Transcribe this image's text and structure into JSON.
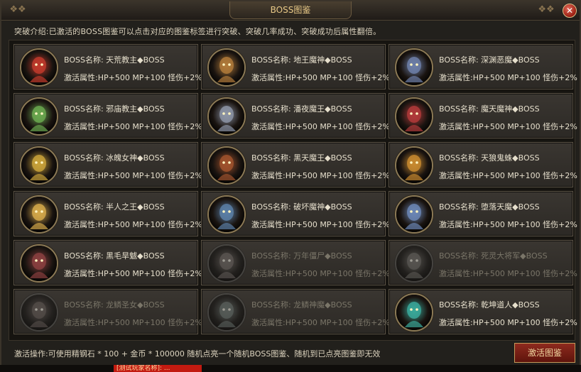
{
  "window": {
    "title": "BOSS图鉴",
    "close_symbol": "✕"
  },
  "intro_text": "突破介绍:已激活的BOSS图鉴可以点击对应的图鉴标签进行突破、突破几率成功、突破成功后属性翻倍。",
  "bosses": [
    {
      "name": "BOSS名称: 天荒教主◆BOSS",
      "attr": "激活属性:HP+500 MP+100 怪伤+2%",
      "locked": false,
      "color": "#c0392b"
    },
    {
      "name": "BOSS名称: 地王魔神◆BOSS",
      "attr": "激活属性:HP+500 MP+100 怪伤+2%",
      "locked": false,
      "color": "#b07a3a"
    },
    {
      "name": "BOSS名称: 深渊恶魔◆BOSS",
      "attr": "激活属性:HP+500 MP+100 怪伤+2%",
      "locked": false,
      "color": "#6d7fa8"
    },
    {
      "name": "BOSS名称: 邪庙教主◆BOSS",
      "attr": "激活属性:HP+500 MP+100 怪伤+2%",
      "locked": false,
      "color": "#6aa84f"
    },
    {
      "name": "BOSS名称: 潘夜魔王◆BOSS",
      "attr": "激活属性:HP+500 MP+100 怪伤+2%",
      "locked": false,
      "color": "#8c94a6"
    },
    {
      "name": "BOSS名称: 魔天魔神◆BOSS",
      "attr": "激活属性:HP+500 MP+100 怪伤+2%",
      "locked": false,
      "color": "#b03a3a"
    },
    {
      "name": "BOSS名称: 冰魄女神◆BOSS",
      "attr": "激活属性:HP+500 MP+100 怪伤+2%",
      "locked": false,
      "color": "#c9a23a"
    },
    {
      "name": "BOSS名称: 黑天魔王◆BOSS",
      "attr": "激活属性:HP+500 MP+100 怪伤+2%",
      "locked": false,
      "color": "#a0522d"
    },
    {
      "name": "BOSS名称: 天狼鬼蛛◆BOSS",
      "attr": "激活属性:HP+500 MP+100 怪伤+2%",
      "locked": false,
      "color": "#c8892f"
    },
    {
      "name": "BOSS名称: 半人之王◆BOSS",
      "attr": "激活属性:HP+500 MP+100 怪伤+2%",
      "locked": false,
      "color": "#d4a84a"
    },
    {
      "name": "BOSS名称: 破坏魔神◆BOSS",
      "attr": "激活属性:HP+500 MP+100 怪伤+2%",
      "locked": false,
      "color": "#5b7fa6"
    },
    {
      "name": "BOSS名称: 堕落天魔◆BOSS",
      "attr": "激活属性:HP+500 MP+100 怪伤+2%",
      "locked": false,
      "color": "#6b86b5"
    },
    {
      "name": "BOSS名称: 黑毛旱魃◆BOSS",
      "attr": "激活属性:HP+500 MP+100 怪伤+2%",
      "locked": false,
      "color": "#8a3f3f"
    },
    {
      "name": "BOSS名称: 万年僵尸◆BOSS",
      "attr": "激活属性:HP+500 MP+100 怪伤+2%",
      "locked": true,
      "color": "#8a6b5a"
    },
    {
      "name": "BOSS名称: 死灵大将军◆BOSS",
      "attr": "激活属性:HP+500 MP+100 怪伤+2%",
      "locked": true,
      "color": "#7a7060"
    },
    {
      "name": "BOSS名称: 龙鳞圣女◆BOSS",
      "attr": "激活属性:HP+500 MP+100 怪伤+2%",
      "locked": true,
      "color": "#8a5a4a"
    },
    {
      "name": "BOSS名称: 龙鳞神魔◆BOSS",
      "attr": "激活属性:HP+500 MP+100 怪伤+2%",
      "locked": true,
      "color": "#4a8a7a"
    },
    {
      "name": "BOSS名称: 乾坤道人◆BOSS",
      "attr": "激活属性:HP+500 MP+100 怪伤+2%",
      "locked": false,
      "color": "#3aa89a"
    }
  ],
  "footer": {
    "operation_text": "激活操作:可使用精钢石 * 100 + 金币 * 100000 随机点亮一个随机BOSS图鉴、随机到已点亮图鉴即无效",
    "activate_button": "激活图鉴"
  },
  "chat_snippet": "[测试玩家名称]: ..."
}
